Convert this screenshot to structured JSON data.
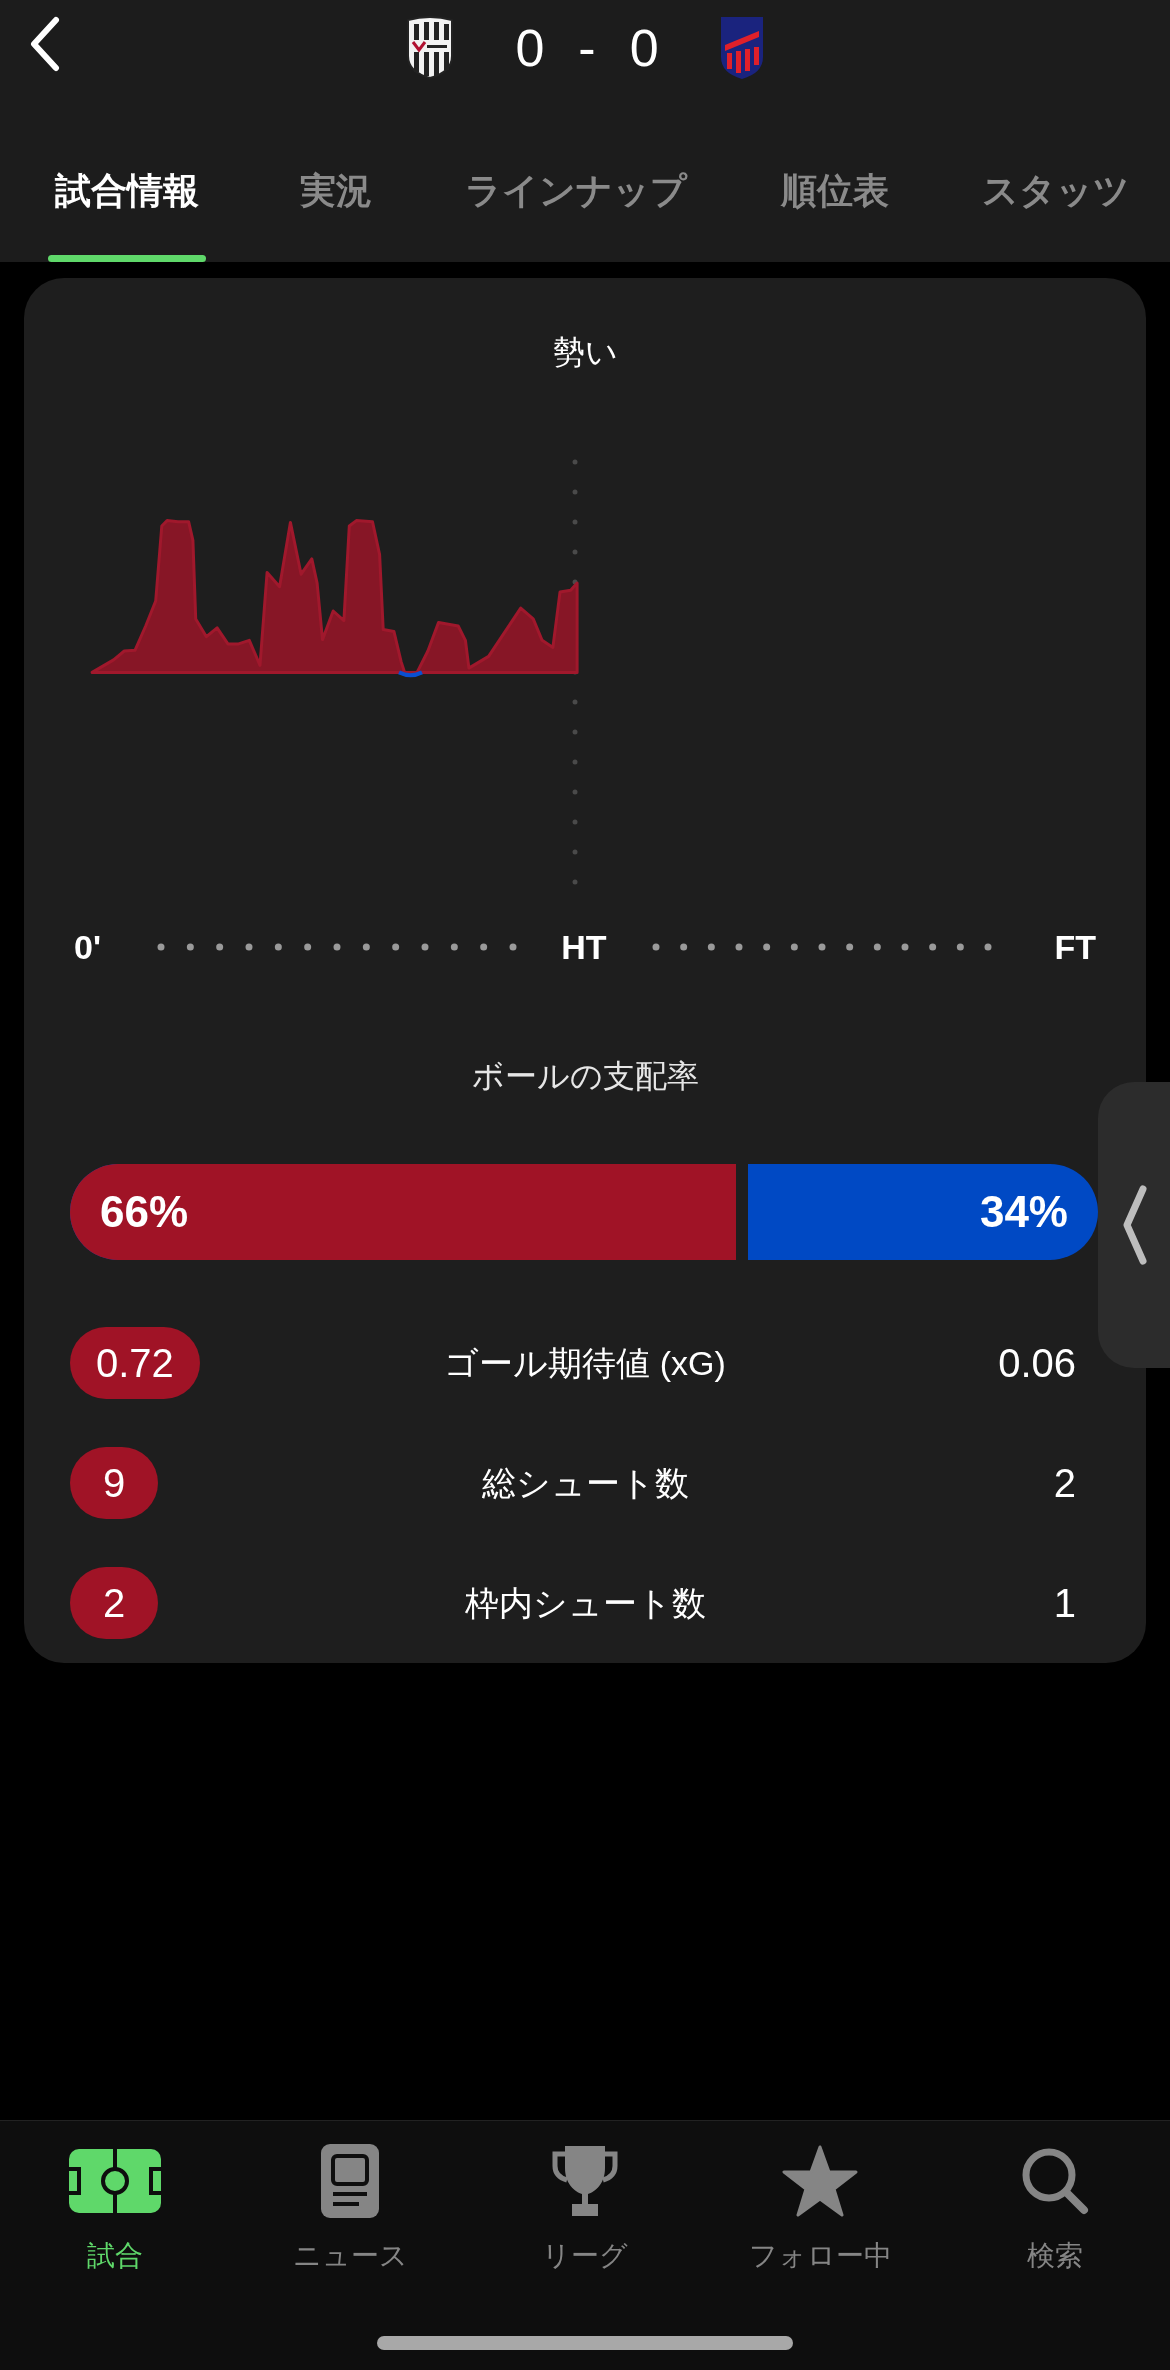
{
  "header": {
    "score": {
      "home": "0",
      "separator": "-",
      "away": "0"
    }
  },
  "tabs": [
    {
      "label": "試合情報",
      "selected": true
    },
    {
      "label": "実況",
      "selected": false
    },
    {
      "label": "ラインナップ",
      "selected": false
    },
    {
      "label": "順位表",
      "selected": false
    },
    {
      "label": "スタッツ",
      "selected": false
    }
  ],
  "momentum": {
    "title": "勢い",
    "axis_labels": [
      "0'",
      "HT",
      "FT"
    ]
  },
  "possession": {
    "title": "ボールの支配率",
    "home": {
      "value": "66%",
      "level": 0.66
    },
    "away": {
      "value": "34%"
    }
  },
  "stats": [
    {
      "label": "ゴール期待値 (xG)",
      "home": "0.72",
      "away": "0.06",
      "home_highlighted": true,
      "away_highlighted": false
    },
    {
      "label": "総シュート数",
      "home": "9",
      "away": "2",
      "home_highlighted": true,
      "away_highlighted": false
    },
    {
      "label": "枠内シュート数",
      "home": "2",
      "away": "1",
      "home_highlighted": true,
      "away_highlighted": false
    }
  ],
  "nav": [
    {
      "label": "試合",
      "kind": "pitch",
      "selected": true
    },
    {
      "label": "ニュース",
      "kind": "news",
      "selected": false
    },
    {
      "label": "リーグ",
      "kind": "trophy",
      "selected": false
    },
    {
      "label": "フォロー中",
      "kind": "star",
      "selected": false
    },
    {
      "label": "検索",
      "kind": "search",
      "selected": false
    }
  ]
}
